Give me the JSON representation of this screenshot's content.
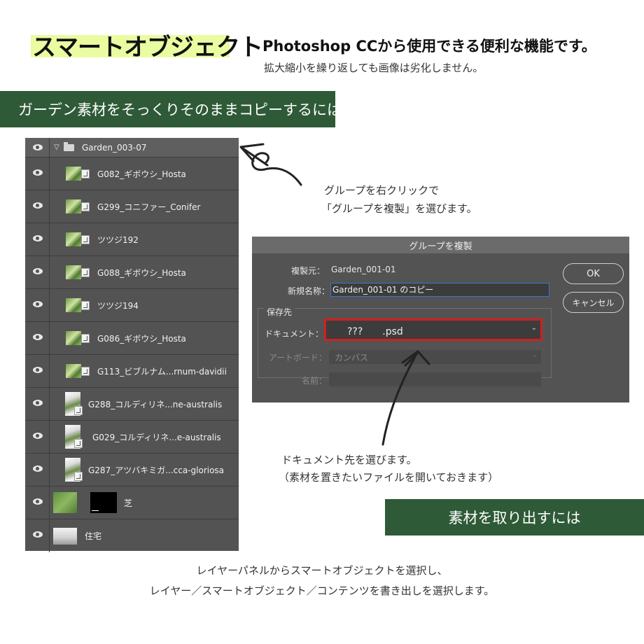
{
  "header": {
    "title": "スマートオブジェクト",
    "headline": "Photoshop CCから使用できる便利な機能です。",
    "subline": "拡大縮小を繰り返しても画像は劣化しません。",
    "highlight_color": "#eafca0"
  },
  "banners": {
    "copy_heading": "ガーデン素材をそっくりそのままコピーするには",
    "extract_heading": "素材を取り出すには",
    "color": "#2f5a37"
  },
  "layers_panel": {
    "group_name": "Garden_003-07",
    "layers": [
      {
        "name": "G082_ギボウシ_Hosta",
        "thumb": "plant"
      },
      {
        "name": "G299_コニファー_Conifer",
        "thumb": "plant"
      },
      {
        "name": "ツツジ192",
        "thumb": "plant"
      },
      {
        "name": "G088_ギボウシ_Hosta",
        "thumb": "plant"
      },
      {
        "name": "ツツジ194",
        "thumb": "plant"
      },
      {
        "name": "G086_ギボウシ_Hosta",
        "thumb": "plant"
      },
      {
        "name": "G113_ビブルナム...rnum-davidii",
        "thumb": "plant"
      },
      {
        "name": "G288_コルディリネ...ne-australis",
        "thumb": "tall"
      },
      {
        "name": "G029_コルディリネ...e-australis",
        "thumb": "tall"
      },
      {
        "name": "G287_アツバキミガ...cca-gloriosa",
        "thumb": "tall"
      }
    ],
    "lawn_layer": "芝",
    "house_layer": "住宅"
  },
  "annotations": {
    "group_note_line1": "グループを右クリックで",
    "group_note_line2": "「グループを複製」を選びます。",
    "doc_note_line1": "ドキュメント先を選びます。",
    "doc_note_line2": "（素材を置きたいファイルを開いておきます）"
  },
  "dialog": {
    "title": "グループを複製",
    "source_label": "複製元：",
    "source_value": "Garden_001-01",
    "newname_label": "新規名称：",
    "newname_value": "Garden_001-01 のコピー",
    "destination_label": "保存先",
    "document_label": "ドキュメント：",
    "document_value": "???　　.psd",
    "artboard_label": "アートボード：",
    "artboard_value": "カンバス",
    "name_label": "名前：",
    "ok_label": "OK",
    "cancel_label": "キャンセル",
    "highlight_color": "#d21f1f"
  },
  "footer": {
    "line1": "レイヤーパネルからスマートオブジェクトを選択し、",
    "line2": "レイヤー／スマートオブジェクト／コンテンツを書き出しを選択します。"
  }
}
